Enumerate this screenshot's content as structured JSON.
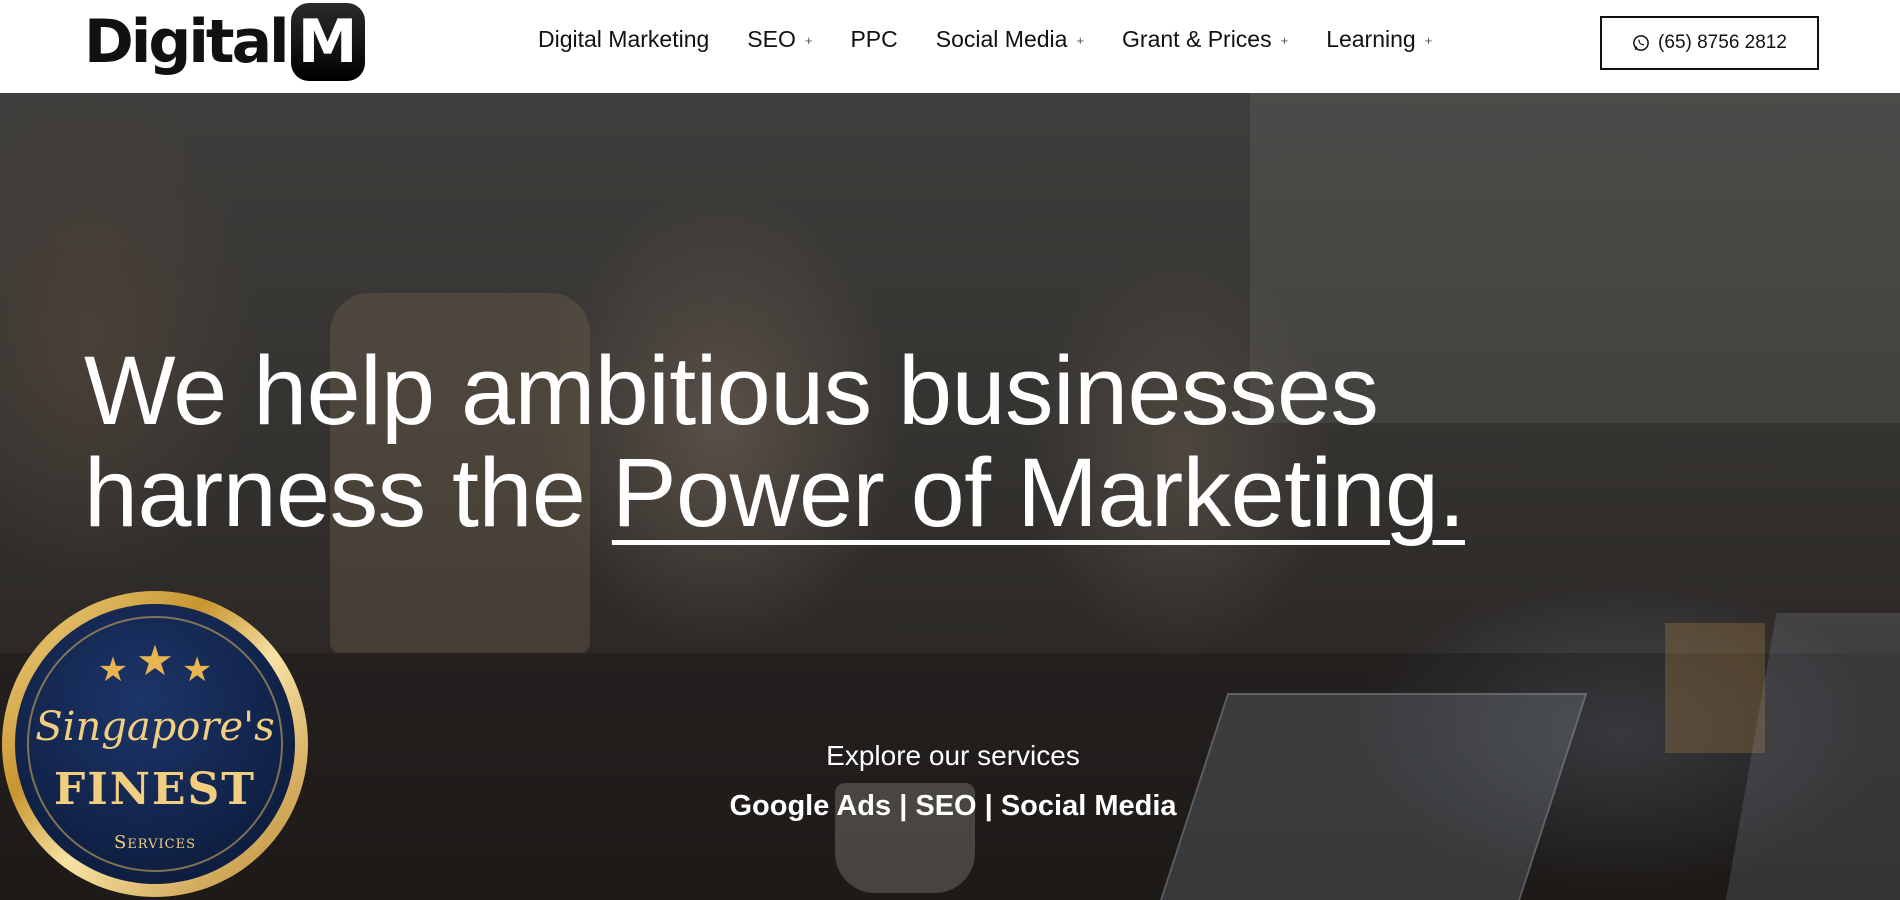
{
  "header": {
    "logo": {
      "text": "Digital",
      "mark": "M"
    },
    "nav": [
      {
        "label": "Digital Marketing",
        "has_submenu": false
      },
      {
        "label": "SEO",
        "has_submenu": true
      },
      {
        "label": "PPC",
        "has_submenu": false
      },
      {
        "label": "Social Media",
        "has_submenu": true
      },
      {
        "label": "Grant & Prices",
        "has_submenu": true
      },
      {
        "label": "Learning",
        "has_submenu": true
      }
    ],
    "submenu_glyph": "+",
    "phone": {
      "label": "(65) 8756 2812",
      "icon": "whatsapp-icon"
    }
  },
  "hero": {
    "headline_line1": "We help ambitious businesses",
    "headline_line2_prefix": "harness the ",
    "headline_line2_accent": "Power of Marketing.",
    "explore_label": "Explore our services",
    "services_links": "Google Ads | SEO | Social Media"
  },
  "badge": {
    "stars": [
      "★",
      "★",
      "★"
    ],
    "script": "Singapore's",
    "title": "FINEST",
    "subtitle": "Services",
    "colors": {
      "gold": "#f2cf80",
      "navy": "#12244b"
    }
  }
}
